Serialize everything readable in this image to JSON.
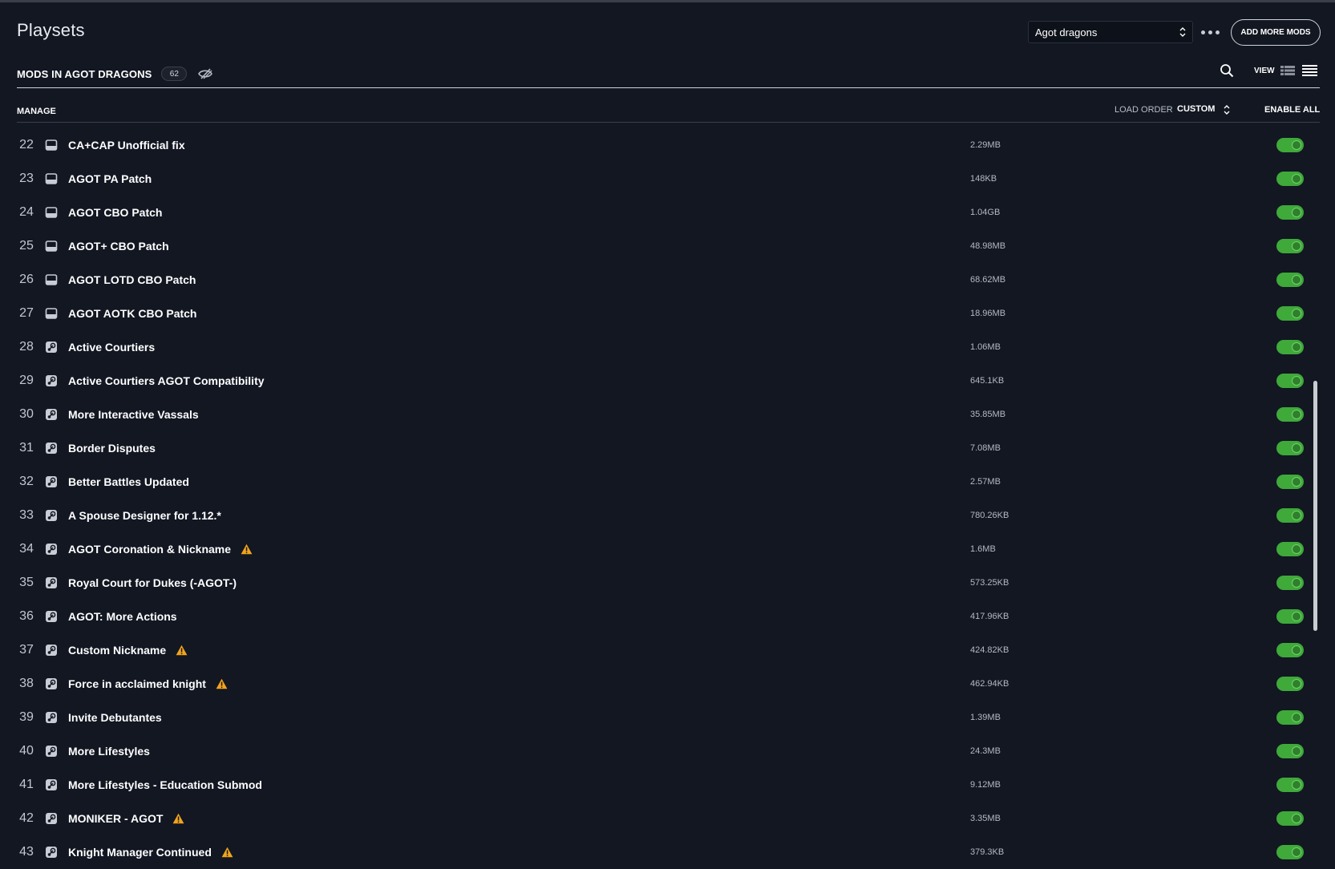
{
  "header": {
    "title": "Playsets",
    "playset_select_value": "Agot dragons",
    "add_mods_label": "ADD MORE MODS"
  },
  "mods_bar": {
    "label": "MODS IN AGOT DRAGONS",
    "count": "62",
    "view_label": "VIEW"
  },
  "list_header": {
    "manage_label": "MANAGE",
    "load_order_label": "LOAD ORDER",
    "load_order_value": "CUSTOM",
    "enable_all_label": "ENABLE ALL"
  },
  "colors": {
    "background": "#121722",
    "toggle_on": "#3fa93a",
    "warning": "#f2a41c"
  },
  "mods": [
    {
      "num": "22",
      "name": "CA+CAP Unofficial fix",
      "size": "2.29MB",
      "source": "local-drive-icon",
      "warning": false,
      "enabled": true
    },
    {
      "num": "23",
      "name": "AGOT PA Patch",
      "size": "148KB",
      "source": "local-drive-icon",
      "warning": false,
      "enabled": true
    },
    {
      "num": "24",
      "name": "AGOT CBO Patch",
      "size": "1.04GB",
      "source": "local-drive-icon",
      "warning": false,
      "enabled": true
    },
    {
      "num": "25",
      "name": "AGOT+ CBO Patch",
      "size": "48.98MB",
      "source": "local-drive-icon",
      "warning": false,
      "enabled": true
    },
    {
      "num": "26",
      "name": "AGOT LOTD CBO Patch",
      "size": "68.62MB",
      "source": "local-drive-icon",
      "warning": false,
      "enabled": true
    },
    {
      "num": "27",
      "name": "AGOT AOTK CBO Patch",
      "size": "18.96MB",
      "source": "local-drive-icon",
      "warning": false,
      "enabled": true
    },
    {
      "num": "28",
      "name": "Active Courtiers",
      "size": "1.06MB",
      "source": "steam-icon",
      "warning": false,
      "enabled": true
    },
    {
      "num": "29",
      "name": "Active Courtiers AGOT Compatibility",
      "size": "645.1KB",
      "source": "steam-icon",
      "warning": false,
      "enabled": true
    },
    {
      "num": "30",
      "name": "More Interactive Vassals",
      "size": "35.85MB",
      "source": "steam-icon",
      "warning": false,
      "enabled": true
    },
    {
      "num": "31",
      "name": "Border Disputes",
      "size": "7.08MB",
      "source": "steam-icon",
      "warning": false,
      "enabled": true
    },
    {
      "num": "32",
      "name": "Better Battles Updated",
      "size": "2.57MB",
      "source": "steam-icon",
      "warning": false,
      "enabled": true
    },
    {
      "num": "33",
      "name": "A Spouse Designer for 1.12.*",
      "size": "780.26KB",
      "source": "steam-icon",
      "warning": false,
      "enabled": true
    },
    {
      "num": "34",
      "name": "AGOT Coronation & Nickname",
      "size": "1.6MB",
      "source": "steam-icon",
      "warning": true,
      "enabled": true
    },
    {
      "num": "35",
      "name": "Royal Court for Dukes (-AGOT-)",
      "size": "573.25KB",
      "source": "steam-icon",
      "warning": false,
      "enabled": true
    },
    {
      "num": "36",
      "name": "AGOT: More Actions",
      "size": "417.96KB",
      "source": "steam-icon",
      "warning": false,
      "enabled": true
    },
    {
      "num": "37",
      "name": "Custom Nickname",
      "size": "424.82KB",
      "source": "steam-icon",
      "warning": true,
      "enabled": true
    },
    {
      "num": "38",
      "name": "Force in acclaimed knight",
      "size": "462.94KB",
      "source": "steam-icon",
      "warning": true,
      "enabled": true
    },
    {
      "num": "39",
      "name": "Invite Debutantes",
      "size": "1.39MB",
      "source": "steam-icon",
      "warning": false,
      "enabled": true
    },
    {
      "num": "40",
      "name": "More Lifestyles",
      "size": "24.3MB",
      "source": "steam-icon",
      "warning": false,
      "enabled": true
    },
    {
      "num": "41",
      "name": "More Lifestyles - Education Submod",
      "size": "9.12MB",
      "source": "steam-icon",
      "warning": false,
      "enabled": true
    },
    {
      "num": "42",
      "name": "MONIKER - AGOT",
      "size": "3.35MB",
      "source": "steam-icon",
      "warning": true,
      "enabled": true
    },
    {
      "num": "43",
      "name": "Knight Manager Continued",
      "size": "379.3KB",
      "source": "steam-icon",
      "warning": true,
      "enabled": true
    }
  ]
}
